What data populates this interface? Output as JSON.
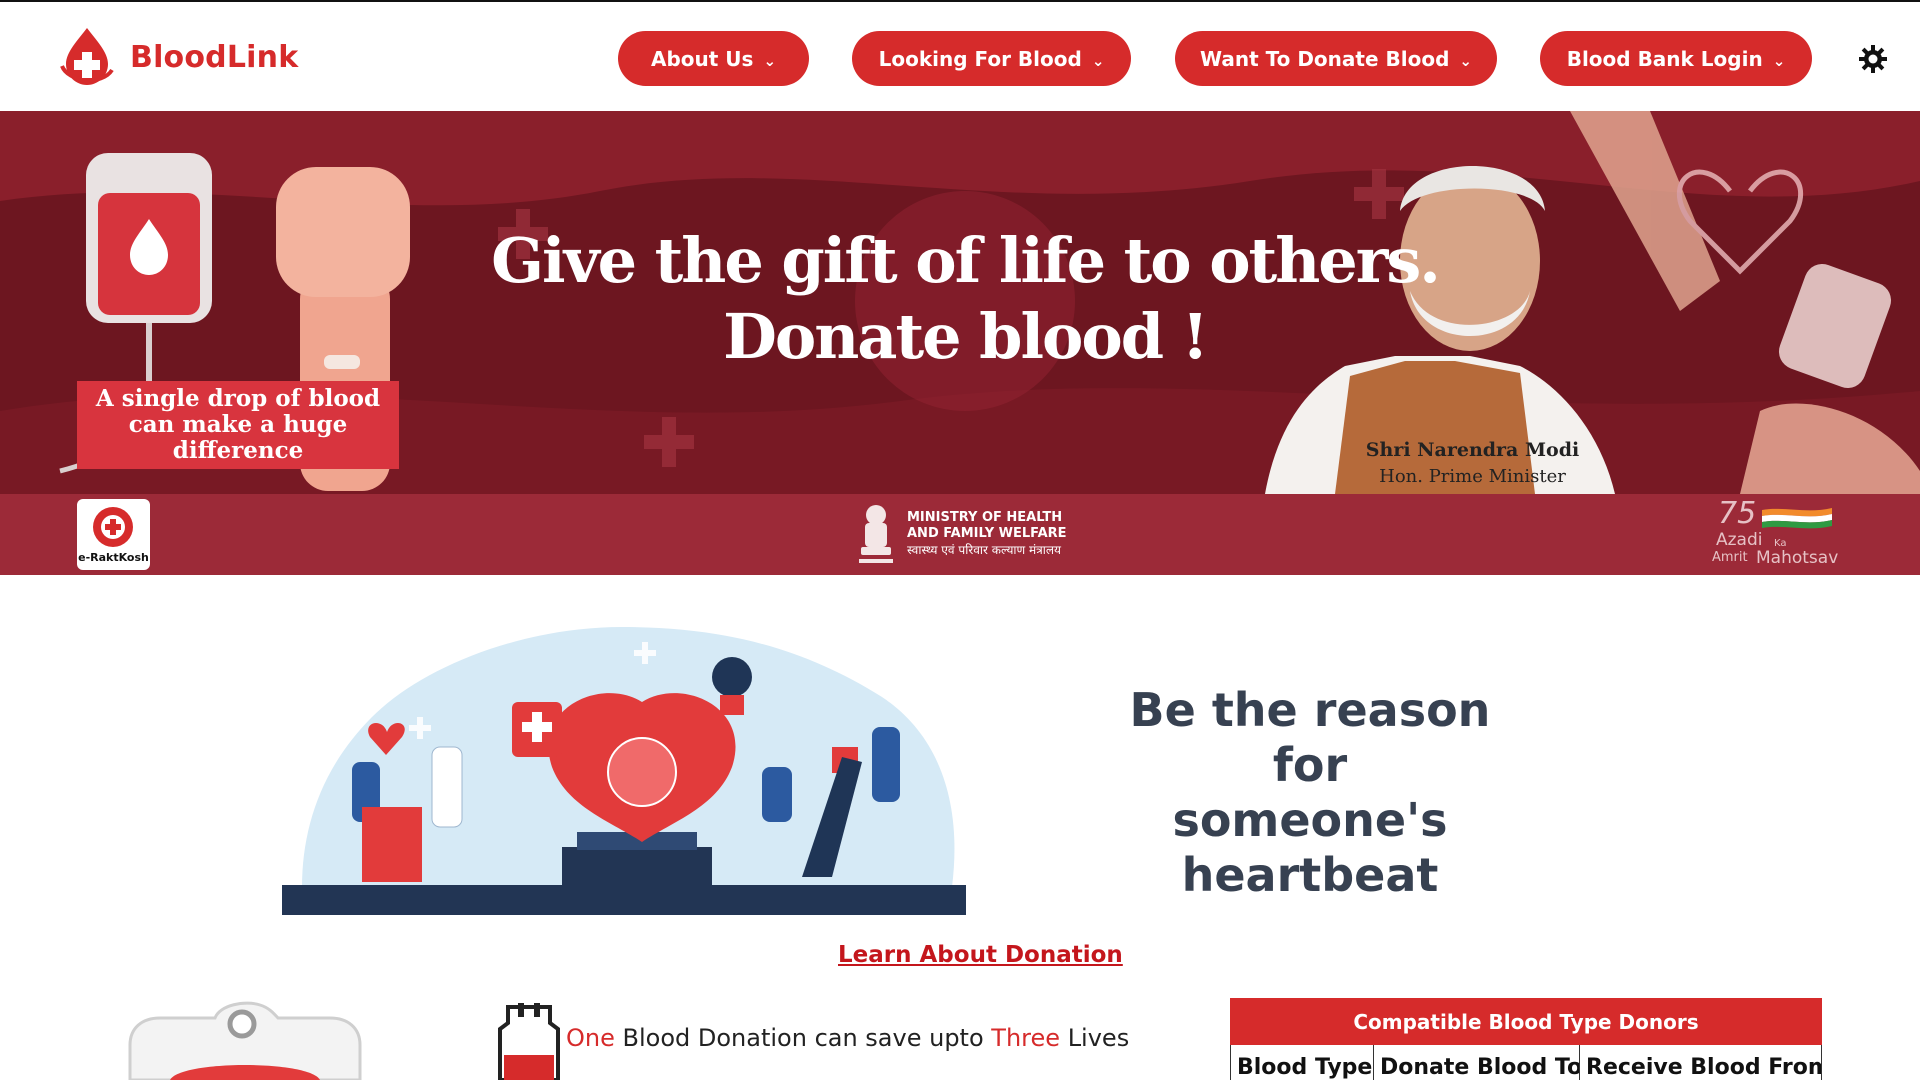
{
  "brand": {
    "name": "BloodLink"
  },
  "nav": {
    "items": [
      {
        "label": "About Us"
      },
      {
        "label": "Looking For Blood"
      },
      {
        "label": "Want To Donate Blood"
      },
      {
        "label": "Blood Bank Login"
      }
    ],
    "theme_icon": "gear-icon"
  },
  "banner": {
    "headline_line1": "Give the gift of life to others.",
    "headline_line2": "Donate blood !",
    "drop_text": "A single drop of blood can make a huge difference",
    "pm_name": "Shri Narendra Modi",
    "pm_title": "Hon. Prime Minister",
    "ekosh_label": "e-RaktKosh",
    "ministry_line1": "MINISTRY OF HEALTH",
    "ministry_line2": "AND FAMILY WELFARE",
    "ministry_hindi": "स्वास्थ्य एवं परिवार कल्याण मंत्रालय",
    "azadi_text1": "Azadi",
    "azadi_text2": "Ka",
    "azadi_text3": "Amrit",
    "azadi_text4": "Mahotsav",
    "azadi_num": "75"
  },
  "main": {
    "tagline_line1": "Be the reason",
    "tagline_line2": "for",
    "tagline_line3": "someone's heartbeat",
    "learn_link": "Learn About Donation",
    "lives_one": "One",
    "lives_mid": "Blood Donation can save upto",
    "lives_three": "Three",
    "lives_end": "Lives"
  },
  "compat_table": {
    "title": "Compatible Blood Type Donors",
    "headers": [
      "Blood Type",
      "Donate Blood To",
      "Receive Blood From"
    ]
  },
  "colors": {
    "accent": "#d62b2b",
    "banner_bg": "#6d1620",
    "strip_bg": "#9c2a38",
    "text_dark": "#374151"
  }
}
